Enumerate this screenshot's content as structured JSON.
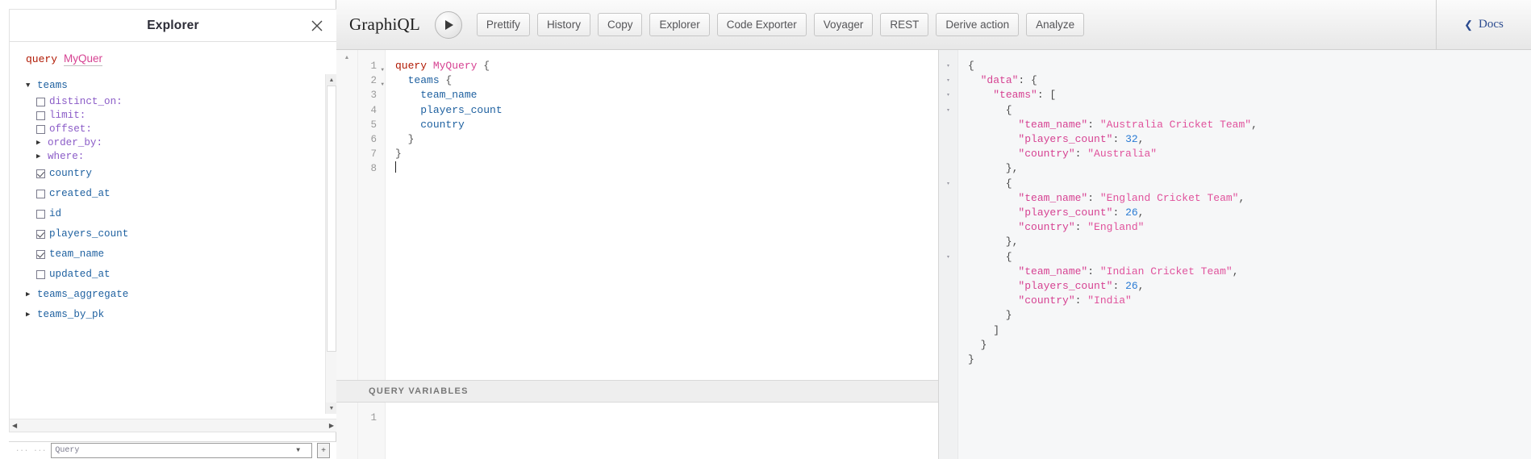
{
  "explorer": {
    "title": "Explorer",
    "close_icon": "close-icon",
    "query_keyword": "query",
    "query_name": "MyQuer",
    "tree": [
      {
        "type": "root",
        "label": "teams",
        "arrow": "down"
      },
      {
        "type": "arg",
        "label": "distinct_on:",
        "checkbox": false
      },
      {
        "type": "arg",
        "label": "limit:",
        "checkbox": false
      },
      {
        "type": "arg",
        "label": "offset:",
        "checkbox": false
      },
      {
        "type": "arg-expand",
        "label": "order_by:",
        "arrow": "right"
      },
      {
        "type": "arg-expand",
        "label": "where:",
        "arrow": "right"
      },
      {
        "type": "field",
        "label": "country",
        "checkbox": true
      },
      {
        "type": "field",
        "label": "created_at",
        "checkbox": false
      },
      {
        "type": "field",
        "label": "id",
        "checkbox": false
      },
      {
        "type": "field",
        "label": "players_count",
        "checkbox": true
      },
      {
        "type": "field",
        "label": "team_name",
        "checkbox": true
      },
      {
        "type": "field",
        "label": "updated_at",
        "checkbox": false
      },
      {
        "type": "root",
        "label": "teams_aggregate",
        "arrow": "right"
      },
      {
        "type": "root",
        "label": "teams_by_pk",
        "arrow": "right"
      }
    ],
    "footer": {
      "muted_left": "···",
      "muted_left2": "···",
      "select_value": "Query",
      "add_label": "+"
    }
  },
  "toolbar": {
    "brand": "GraphiQL",
    "execute_icon": "play-icon",
    "buttons": [
      "Prettify",
      "History",
      "Copy",
      "Explorer",
      "Code Exporter",
      "Voyager",
      "REST",
      "Derive action",
      "Analyze"
    ],
    "docs_label": "Docs",
    "docs_chevron": "chevron-left-icon"
  },
  "query_editor": {
    "line_numbers": [
      "1",
      "2",
      "3",
      "4",
      "5",
      "6",
      "7",
      "8"
    ],
    "fold_lines": [
      1,
      2
    ],
    "lines": [
      [
        {
          "t": "query",
          "c": "c-kw"
        },
        {
          "t": " ",
          "c": "c-punct"
        },
        {
          "t": "MyQuery",
          "c": "c-opname"
        },
        {
          "t": " {",
          "c": "c-punct"
        }
      ],
      [
        {
          "t": "  ",
          "c": "c-punct"
        },
        {
          "t": "teams",
          "c": "c-field"
        },
        {
          "t": " {",
          "c": "c-punct"
        }
      ],
      [
        {
          "t": "    ",
          "c": "c-punct"
        },
        {
          "t": "team_name",
          "c": "c-field"
        }
      ],
      [
        {
          "t": "    ",
          "c": "c-punct"
        },
        {
          "t": "players_count",
          "c": "c-field"
        }
      ],
      [
        {
          "t": "    ",
          "c": "c-punct"
        },
        {
          "t": "country",
          "c": "c-field"
        }
      ],
      [
        {
          "t": "  }",
          "c": "c-punct"
        }
      ],
      [
        {
          "t": "}",
          "c": "c-punct"
        }
      ],
      []
    ],
    "raw_text": "query MyQuery {\n  teams {\n    team_name\n    players_count\n    country\n  }\n}\n"
  },
  "query_variables": {
    "header": "QUERY VARIABLES",
    "line_numbers": [
      "1"
    ],
    "value": ""
  },
  "result": {
    "fold_markers": [
      "▾",
      "▾",
      "▾",
      "▾",
      "",
      "",
      "",
      "",
      "▾",
      "",
      "",
      "",
      "",
      "▾"
    ],
    "lines": [
      [
        {
          "t": "{",
          "c": "r-punct"
        }
      ],
      [
        {
          "t": "  ",
          "c": "r-punct"
        },
        {
          "t": "\"data\"",
          "c": "r-key"
        },
        {
          "t": ": {",
          "c": "r-punct"
        }
      ],
      [
        {
          "t": "    ",
          "c": "r-punct"
        },
        {
          "t": "\"teams\"",
          "c": "r-key"
        },
        {
          "t": ": [",
          "c": "r-punct"
        }
      ],
      [
        {
          "t": "      {",
          "c": "r-punct"
        }
      ],
      [
        {
          "t": "        ",
          "c": "r-punct"
        },
        {
          "t": "\"team_name\"",
          "c": "r-key"
        },
        {
          "t": ": ",
          "c": "r-punct"
        },
        {
          "t": "\"Australia Cricket Team\"",
          "c": "r-str"
        },
        {
          "t": ",",
          "c": "r-punct"
        }
      ],
      [
        {
          "t": "        ",
          "c": "r-punct"
        },
        {
          "t": "\"players_count\"",
          "c": "r-key"
        },
        {
          "t": ": ",
          "c": "r-punct"
        },
        {
          "t": "32",
          "c": "r-num"
        },
        {
          "t": ",",
          "c": "r-punct"
        }
      ],
      [
        {
          "t": "        ",
          "c": "r-punct"
        },
        {
          "t": "\"country\"",
          "c": "r-key"
        },
        {
          "t": ": ",
          "c": "r-punct"
        },
        {
          "t": "\"Australia\"",
          "c": "r-str"
        }
      ],
      [
        {
          "t": "      },",
          "c": "r-punct"
        }
      ],
      [
        {
          "t": "      {",
          "c": "r-punct"
        }
      ],
      [
        {
          "t": "        ",
          "c": "r-punct"
        },
        {
          "t": "\"team_name\"",
          "c": "r-key"
        },
        {
          "t": ": ",
          "c": "r-punct"
        },
        {
          "t": "\"England Cricket Team\"",
          "c": "r-str"
        },
        {
          "t": ",",
          "c": "r-punct"
        }
      ],
      [
        {
          "t": "        ",
          "c": "r-punct"
        },
        {
          "t": "\"players_count\"",
          "c": "r-key"
        },
        {
          "t": ": ",
          "c": "r-punct"
        },
        {
          "t": "26",
          "c": "r-num"
        },
        {
          "t": ",",
          "c": "r-punct"
        }
      ],
      [
        {
          "t": "        ",
          "c": "r-punct"
        },
        {
          "t": "\"country\"",
          "c": "r-key"
        },
        {
          "t": ": ",
          "c": "r-punct"
        },
        {
          "t": "\"England\"",
          "c": "r-str"
        }
      ],
      [
        {
          "t": "      },",
          "c": "r-punct"
        }
      ],
      [
        {
          "t": "      {",
          "c": "r-punct"
        }
      ],
      [
        {
          "t": "        ",
          "c": "r-punct"
        },
        {
          "t": "\"team_name\"",
          "c": "r-key"
        },
        {
          "t": ": ",
          "c": "r-punct"
        },
        {
          "t": "\"Indian Cricket Team\"",
          "c": "r-str"
        },
        {
          "t": ",",
          "c": "r-punct"
        }
      ],
      [
        {
          "t": "        ",
          "c": "r-punct"
        },
        {
          "t": "\"players_count\"",
          "c": "r-key"
        },
        {
          "t": ": ",
          "c": "r-punct"
        },
        {
          "t": "26",
          "c": "r-num"
        },
        {
          "t": ",",
          "c": "r-punct"
        }
      ],
      [
        {
          "t": "        ",
          "c": "r-punct"
        },
        {
          "t": "\"country\"",
          "c": "r-key"
        },
        {
          "t": ": ",
          "c": "r-punct"
        },
        {
          "t": "\"India\"",
          "c": "r-str"
        }
      ],
      [
        {
          "t": "      }",
          "c": "r-punct"
        }
      ],
      [
        {
          "t": "    ]",
          "c": "r-punct"
        }
      ],
      [
        {
          "t": "  }",
          "c": "r-punct"
        }
      ],
      [
        {
          "t": "}",
          "c": "r-punct"
        }
      ]
    ],
    "data": {
      "data": {
        "teams": [
          {
            "team_name": "Australia Cricket Team",
            "players_count": 32,
            "country": "Australia"
          },
          {
            "team_name": "England Cricket Team",
            "players_count": 26,
            "country": "England"
          },
          {
            "team_name": "Indian Cricket Team",
            "players_count": 26,
            "country": "India"
          }
        ]
      }
    }
  }
}
